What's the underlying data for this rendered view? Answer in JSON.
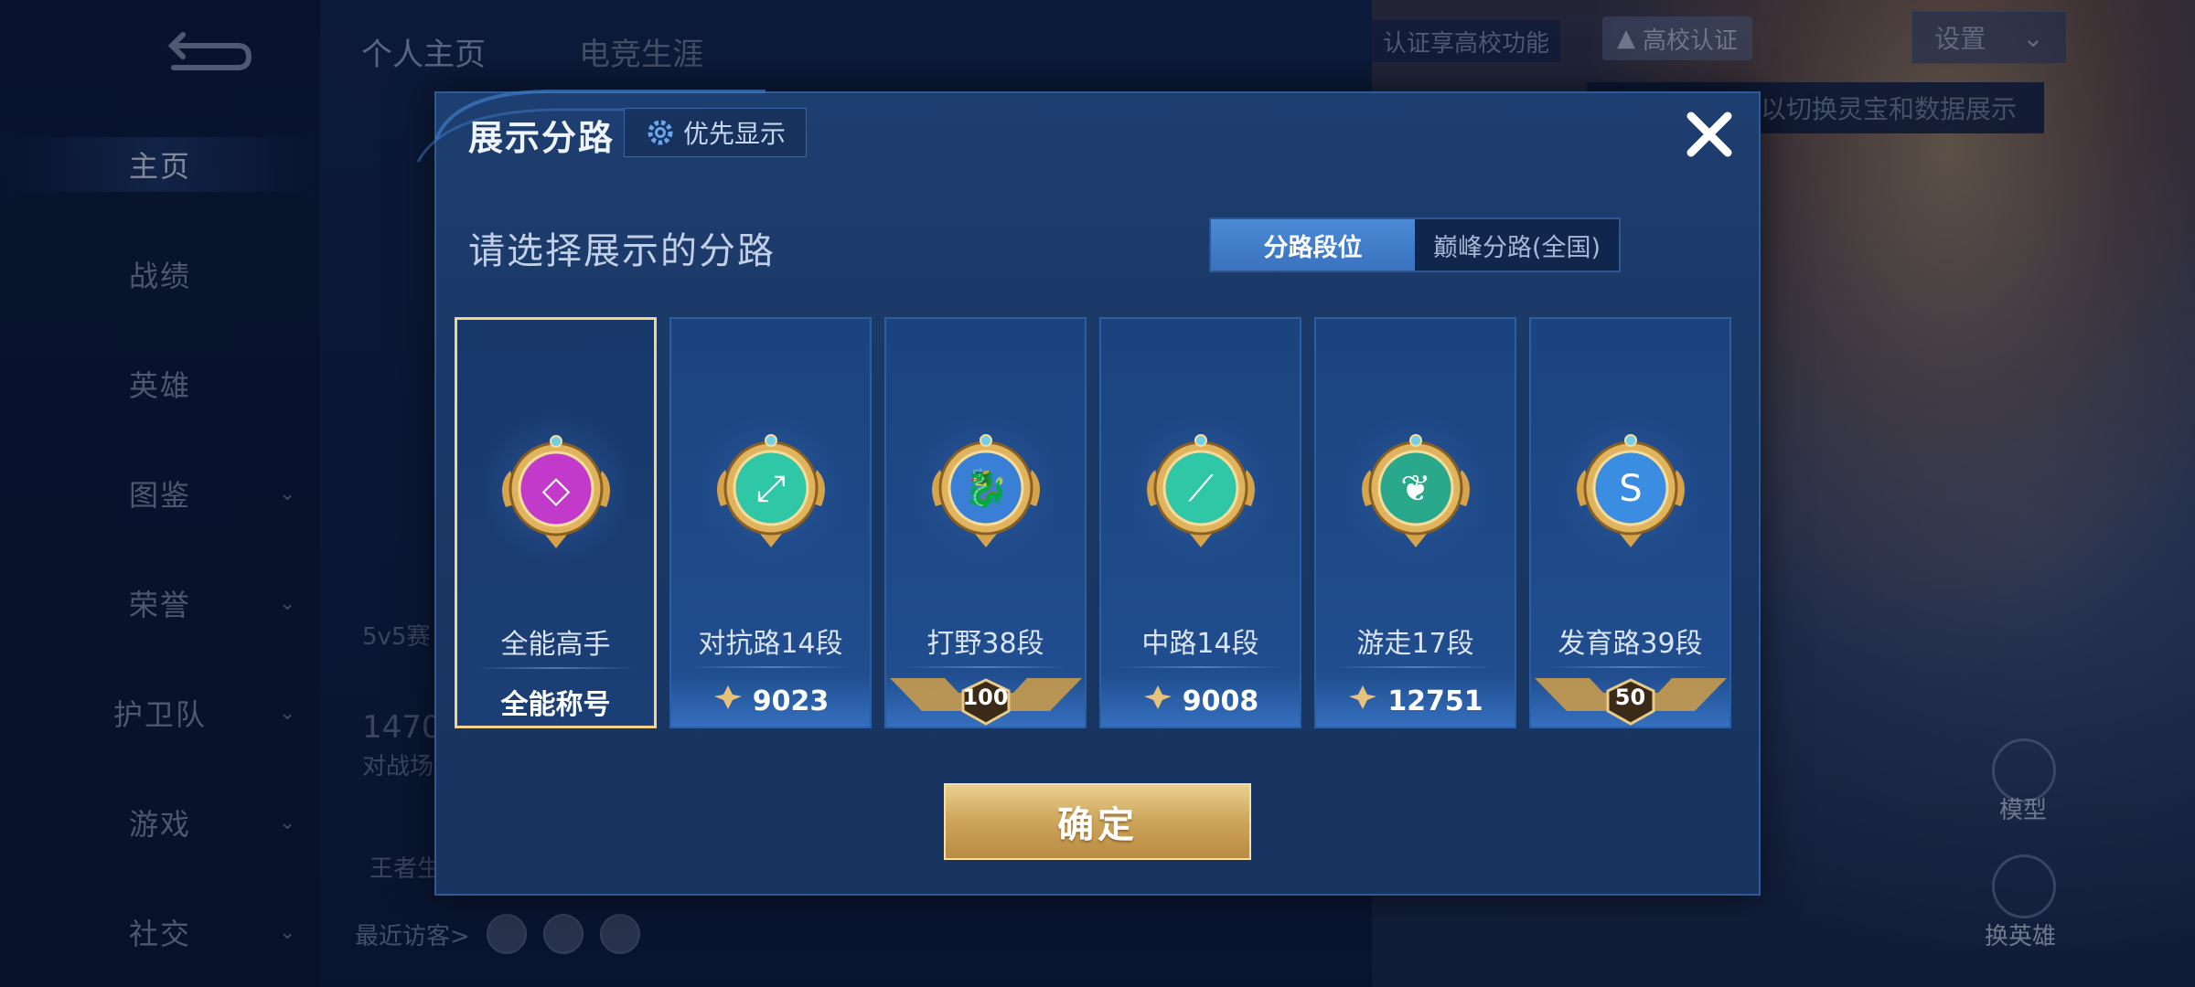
{
  "app": {
    "top_tabs": [
      "个人主页",
      "电竞生涯"
    ],
    "sidebar": [
      {
        "label": "主页",
        "chevron": false,
        "active": true
      },
      {
        "label": "战绩",
        "chevron": false
      },
      {
        "label": "英雄",
        "chevron": false
      },
      {
        "label": "图鉴",
        "chevron": true
      },
      {
        "label": "荣誉",
        "chevron": true
      },
      {
        "label": "护卫队",
        "chevron": true
      },
      {
        "label": "游戏",
        "chevron": true
      },
      {
        "label": "社交",
        "chevron": true
      }
    ],
    "cert_text": "认证享高校功能",
    "cert_button": "高校认证",
    "settings": "设置",
    "hint": "以切换灵宝和数据展示",
    "recent_visitors": "最近访客>",
    "bg_text_1": "5v5赛",
    "bg_text_2": "1470",
    "bg_text_3": "对战场",
    "bg_text_4": "王者生",
    "bg_right_1": "模型",
    "bg_right_2": "换英雄"
  },
  "modal": {
    "title": "展示分路",
    "priority_button": "优先显示",
    "subtitle": "请选择展示的分路",
    "segments": [
      {
        "label": "分路段位",
        "active": true
      },
      {
        "label": "巅峰分路(全国)",
        "active": false
      }
    ],
    "cards": [
      {
        "name": "全能高手",
        "footer": "全能称号",
        "footer_type": "text",
        "medal_color": "#c23ac9",
        "selected": true
      },
      {
        "name": "对抗路14段",
        "footer": "9023",
        "footer_type": "points",
        "medal_color": "#2fc7a6",
        "selected": false
      },
      {
        "name": "打野38段",
        "footer": "100",
        "footer_type": "rank",
        "medal_color": "#3a7fd6",
        "selected": false
      },
      {
        "name": "中路14段",
        "footer": "9008",
        "footer_type": "points",
        "medal_color": "#2fc7a6",
        "selected": false
      },
      {
        "name": "游走17段",
        "footer": "12751",
        "footer_type": "points",
        "medal_color": "#2aa88c",
        "selected": false
      },
      {
        "name": "发育路39段",
        "footer": "50",
        "footer_type": "rank",
        "medal_color": "#3a8de0",
        "selected": false
      }
    ],
    "confirm": "确定"
  },
  "colors": {
    "accent_gold": "#f6d38a",
    "segment_active": "#4b8ad6",
    "modal_bg": "#1b3b6b"
  }
}
